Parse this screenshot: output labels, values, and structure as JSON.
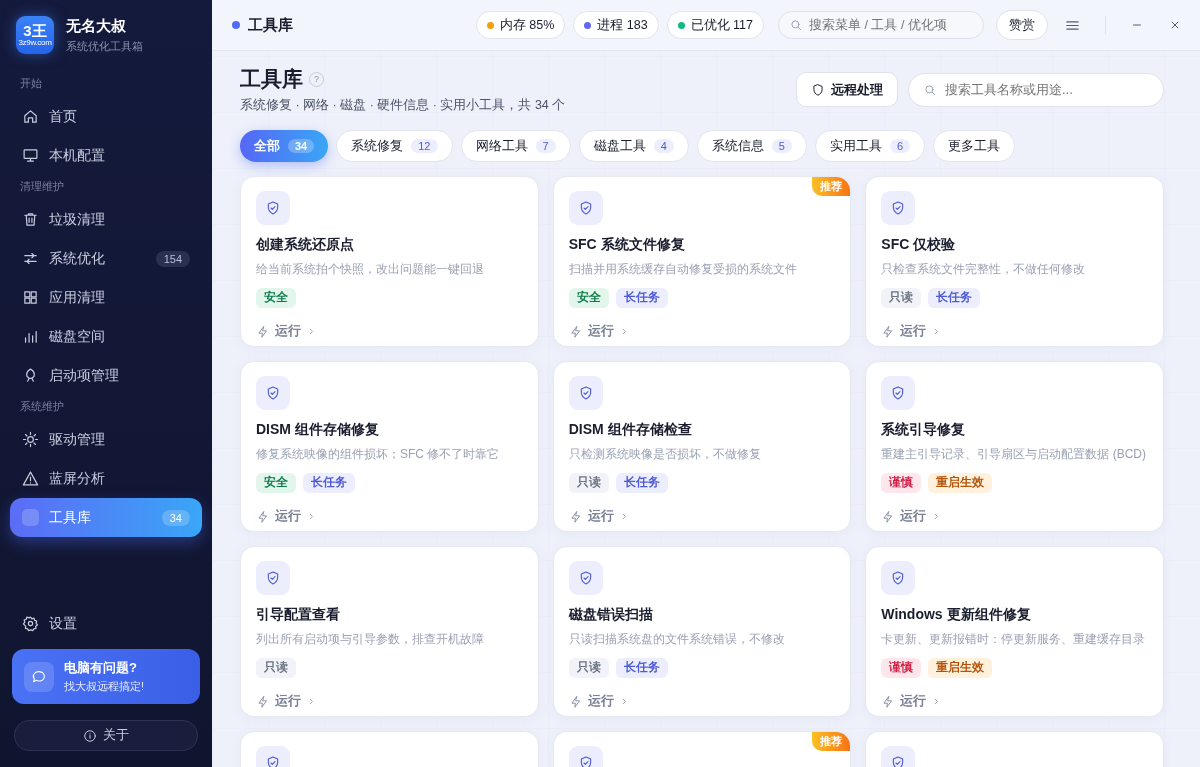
{
  "sidebar": {
    "logo_text": "3王",
    "logo_caption": "3z9w.com",
    "app_name": "无名大叔",
    "app_subtitle": "系统优化工具箱",
    "sections": [
      {
        "label": "开始",
        "items": [
          {
            "label": "首页",
            "selected": false
          },
          {
            "label": "本机配置",
            "selected": false
          }
        ]
      },
      {
        "label": "清理维护",
        "items": [
          {
            "label": "垃圾清理",
            "selected": false
          },
          {
            "label": "系统优化",
            "badge": "154",
            "selected": false
          },
          {
            "label": "应用清理",
            "selected": false
          },
          {
            "label": "磁盘空间",
            "selected": false
          },
          {
            "label": "启动项管理",
            "selected": false
          }
        ]
      },
      {
        "label": "系统维护",
        "items": [
          {
            "label": "驱动管理",
            "selected": false
          },
          {
            "label": "蓝屏分析",
            "selected": false
          },
          {
            "label": "工具库",
            "badge": "34",
            "selected": true
          }
        ]
      }
    ],
    "settings": "设置",
    "promo": {
      "title": "电脑有问题?",
      "subtitle": "找大叔远程搞定!"
    },
    "about": "关于"
  },
  "topbar": {
    "title": "工具库",
    "stats": [
      {
        "label": "内存 85%",
        "color": "#f59e0b"
      },
      {
        "label": "进程 183",
        "color": "#6366f1"
      },
      {
        "label": "已优化 117",
        "color": "#10b981"
      }
    ],
    "search_placeholder": "搜索菜单 / 工具 / 优化项",
    "donate": "赞赏"
  },
  "page": {
    "title": "工具库",
    "help": "?",
    "subtitle": "系统修复 · 网络 · 磁盘 · 硬件信息 · 实用小工具，共 34 个",
    "remote_button": "远程处理",
    "search_placeholder": "搜索工具名称或用途..."
  },
  "filters": [
    {
      "label": "全部",
      "count": "34",
      "selected": true
    },
    {
      "label": "系统修复",
      "count": "12",
      "selected": false
    },
    {
      "label": "网络工具",
      "count": "7",
      "selected": false
    },
    {
      "label": "磁盘工具",
      "count": "4",
      "selected": false
    },
    {
      "label": "系统信息",
      "count": "5",
      "selected": false
    },
    {
      "label": "实用工具",
      "count": "6",
      "selected": false
    },
    {
      "label": "更多工具",
      "selected": false
    }
  ],
  "cards": [
    {
      "title": "创建系统还原点",
      "description": "给当前系统拍个快照，改出问题能一键回退",
      "tags": [
        {
          "label": "安全",
          "kind": "safe"
        }
      ],
      "action": "运行"
    },
    {
      "title": "SFC 系统文件修复",
      "description": "扫描并用系统缓存自动修复受损的系统文件",
      "tags": [
        {
          "label": "安全",
          "kind": "safe"
        },
        {
          "label": "长任务",
          "kind": "long"
        }
      ],
      "action": "运行",
      "badge": "推荐"
    },
    {
      "title": "SFC 仅校验",
      "description": "只检查系统文件完整性，不做任何修改",
      "tags": [
        {
          "label": "只读",
          "kind": "readonly"
        },
        {
          "label": "长任务",
          "kind": "long"
        }
      ],
      "action": "运行"
    },
    {
      "title": "DISM 组件存储修复",
      "description": "修复系统映像的组件损坏；SFC 修不了时靠它",
      "tags": [
        {
          "label": "安全",
          "kind": "safe"
        },
        {
          "label": "长任务",
          "kind": "long"
        }
      ],
      "action": "运行"
    },
    {
      "title": "DISM 组件存储检查",
      "description": "只检测系统映像是否损坏，不做修复",
      "tags": [
        {
          "label": "只读",
          "kind": "readonly"
        },
        {
          "label": "长任务",
          "kind": "long"
        }
      ],
      "action": "运行"
    },
    {
      "title": "系统引导修复",
      "description": "重建主引导记录、引导扇区与启动配置数据 (BCD)",
      "tags": [
        {
          "label": "谨慎",
          "kind": "caution"
        },
        {
          "label": "重启生效",
          "kind": "restart"
        }
      ],
      "action": "运行"
    },
    {
      "title": "引导配置查看",
      "description": "列出所有启动项与引导参数，排查开机故障",
      "tags": [
        {
          "label": "只读",
          "kind": "readonly"
        }
      ],
      "action": "运行"
    },
    {
      "title": "磁盘错误扫描",
      "description": "只读扫描系统盘的文件系统错误，不修改",
      "tags": [
        {
          "label": "只读",
          "kind": "readonly"
        },
        {
          "label": "长任务",
          "kind": "long"
        }
      ],
      "action": "运行"
    },
    {
      "title": "Windows 更新组件修复",
      "description": "卡更新、更新报错时：停更新服务、重建缓存目录",
      "tags": [
        {
          "label": "谨慎",
          "kind": "caution"
        },
        {
          "label": "重启生效",
          "kind": "restart"
        }
      ],
      "action": "运行"
    },
    {
      "partial": true
    },
    {
      "partial": true,
      "badge": "推荐"
    },
    {
      "partial": true
    }
  ]
}
